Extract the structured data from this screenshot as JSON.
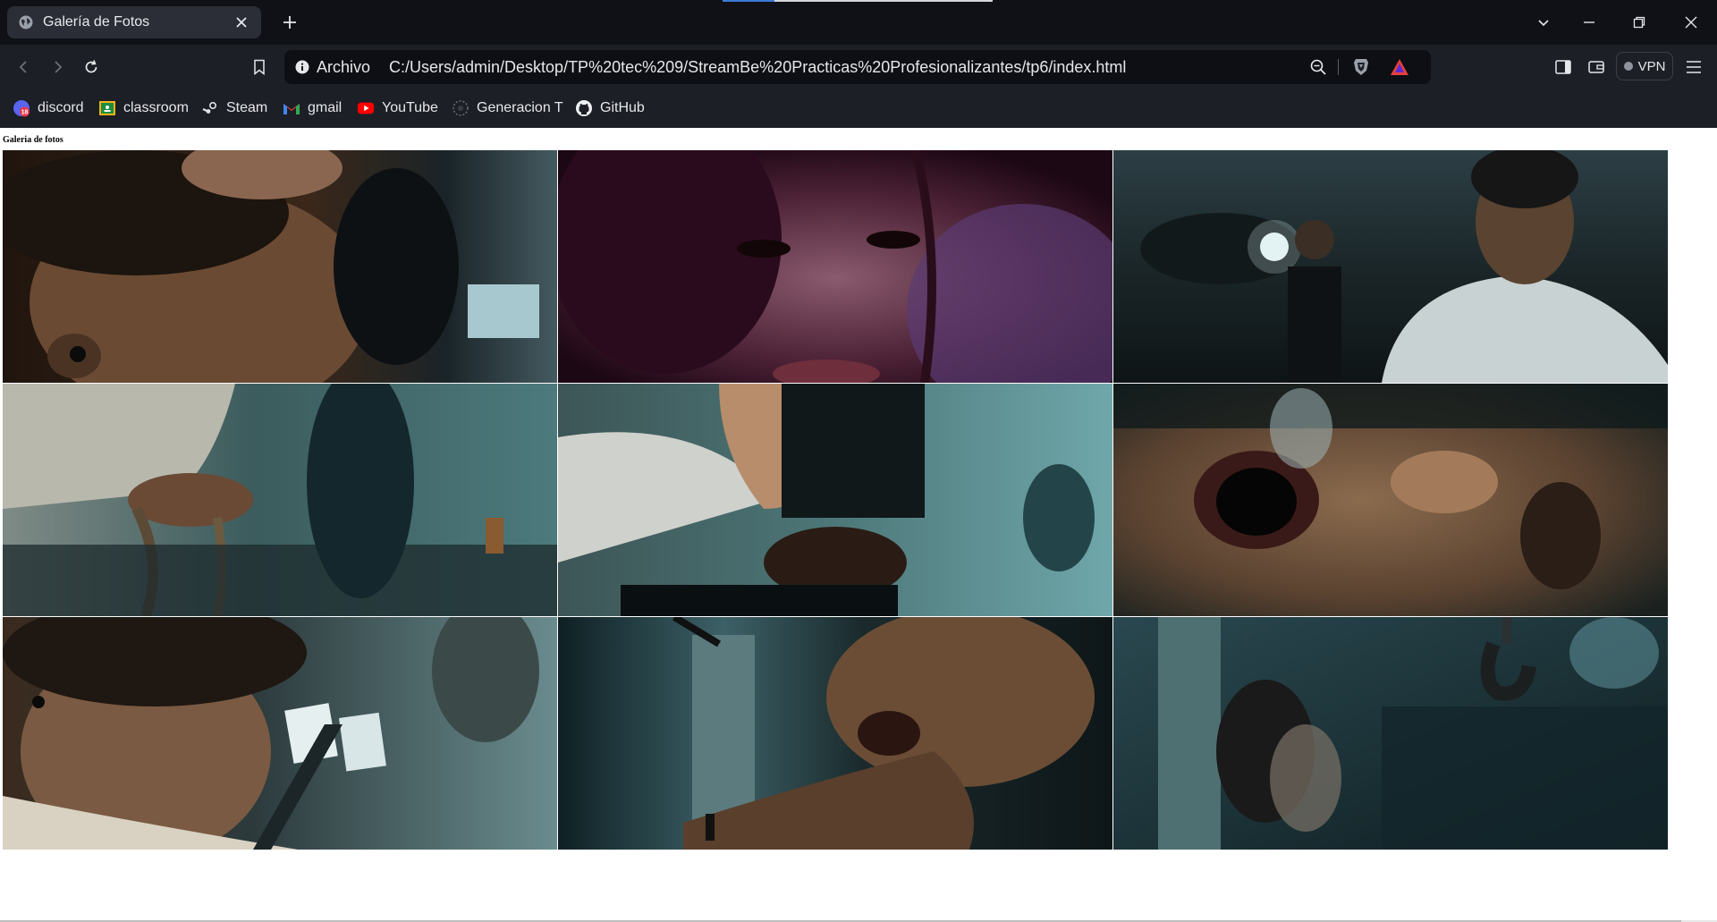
{
  "browser": {
    "tab": {
      "title": "Galería de Fotos",
      "favicon": "globe-icon",
      "close_icon": "close-icon"
    },
    "new_tab_icon": "plus-icon",
    "window_controls": [
      "tab-search-icon",
      "minimize-icon",
      "restore-icon",
      "close-icon"
    ],
    "nav": [
      "back-icon",
      "forward-icon",
      "reload-icon",
      "bookmark-icon"
    ],
    "address": {
      "scheme_label": "Archivo",
      "url": "C:/Users/admin/Desktop/TP%20tec%209/StreamBe%20Practicas%20Profesionalizantes/tp6/index.html"
    },
    "vpn_label": "VPN",
    "bookmarks": [
      {
        "label": "discord",
        "icon": "discord-icon",
        "badge": "18"
      },
      {
        "label": "classroom",
        "icon": "classroom-icon"
      },
      {
        "label": "Steam",
        "icon": "steam-icon"
      },
      {
        "label": "gmail",
        "icon": "gmail-icon"
      },
      {
        "label": "YouTube",
        "icon": "youtube-icon"
      },
      {
        "label": "Generacion T",
        "icon": "generacion-t-icon"
      },
      {
        "label": "GitHub",
        "icon": "github-icon"
      }
    ],
    "colors": {
      "tabstrip": "#0f1116",
      "toolbar": "#1c1f26",
      "url_bg": "#0d0f14",
      "accent": "#3d7ad6"
    }
  },
  "page": {
    "heading": "Galeria de fotos",
    "photos": [
      "man-held-by-head-photo",
      "woman-closeup-purple-photo",
      "man-with-flashlight-night-photo",
      "tied-hands-rope-photo",
      "head-pushed-into-bucket-photo",
      "face-underwater-photo",
      "man-looking-down-photo",
      "hand-on-jaw-photo",
      "crane-hook-scene-photo"
    ]
  }
}
